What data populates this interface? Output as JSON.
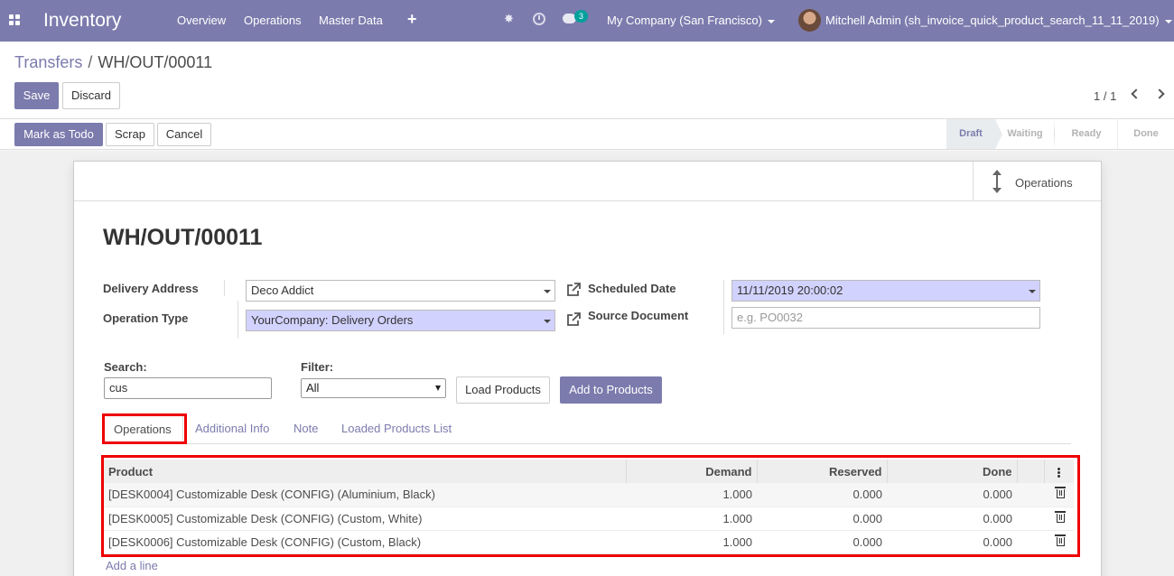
{
  "nav": {
    "brand": "Inventory",
    "menu": [
      "Overview",
      "Operations",
      "Master Data"
    ],
    "plus": "+",
    "bug": "✸",
    "chat_count": "3",
    "company": "My Company (San Francisco)",
    "user": "Mitchell Admin (sh_invoice_quick_product_search_11_11_2019)"
  },
  "breadcrumb": {
    "parent": "Transfers",
    "separator": "/",
    "current": "WH/OUT/00011"
  },
  "actions": {
    "save": "Save",
    "discard": "Discard"
  },
  "pager": {
    "value": "1 / 1"
  },
  "status_buttons": {
    "mark_todo": "Mark as Todo",
    "scrap": "Scrap",
    "cancel": "Cancel"
  },
  "stages": [
    {
      "label": "Draft",
      "active": true
    },
    {
      "label": "Waiting",
      "active": false
    },
    {
      "label": "Ready",
      "active": false
    },
    {
      "label": "Done",
      "active": false
    }
  ],
  "smart_button": {
    "label": "Operations",
    "icon": "arrows-v-icon"
  },
  "record": {
    "title": "WH/OUT/00011",
    "delivery_address_label": "Delivery Address",
    "delivery_address": "Deco Addict",
    "operation_type_label": "Operation Type",
    "operation_type": "YourCompany: Delivery Orders",
    "scheduled_date_label": "Scheduled Date",
    "scheduled_date": "11/11/2019 20:00:02",
    "source_document_label": "Source Document",
    "source_document_placeholder": "e.g. PO0032"
  },
  "quick_search": {
    "search_label": "Search:",
    "search_value": "cus",
    "filter_label": "Filter:",
    "filter_value": "All",
    "load_button": "Load Products",
    "add_button": "Add to Products"
  },
  "tabs": [
    "Operations",
    "Additional Info",
    "Note",
    "Loaded Products List"
  ],
  "table": {
    "headers": {
      "product": "Product",
      "demand": "Demand",
      "reserved": "Reserved",
      "done": "Done"
    },
    "rows": [
      {
        "product": "[DESK0004] Customizable Desk (CONFIG) (Aluminium, Black)",
        "demand": "1.000",
        "reserved": "0.000",
        "done": "0.000"
      },
      {
        "product": "[DESK0005] Customizable Desk (CONFIG) (Custom, White)",
        "demand": "1.000",
        "reserved": "0.000",
        "done": "0.000"
      },
      {
        "product": "[DESK0006] Customizable Desk (CONFIG) (Custom, Black)",
        "demand": "1.000",
        "reserved": "0.000",
        "done": "0.000"
      }
    ],
    "add_line": "Add a line"
  },
  "colors": {
    "brand": "#7c7bad",
    "required_field": "#d2d2ff",
    "highlight": "#e00000"
  }
}
